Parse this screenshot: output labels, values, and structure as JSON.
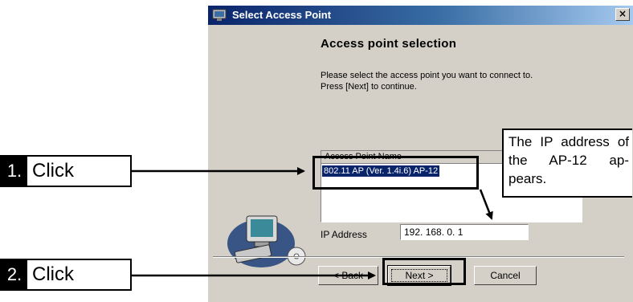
{
  "window": {
    "title": "Select Access Point",
    "close_glyph": "×"
  },
  "page": {
    "heading": "Access point selection",
    "instructions": [
      "Please select the access point you want to connect to.",
      "Press [Next] to continue."
    ]
  },
  "access_point_list": {
    "column_header": "Access Point Name",
    "items": [
      "802.11 AP (Ver. 1.4i.6) AP-12"
    ],
    "selected_index": 0
  },
  "ip_address": {
    "label": "IP Address",
    "value": "192. 168.   0.   1"
  },
  "buttons": {
    "back": "< Back",
    "next": "Next >",
    "cancel": "Cancel"
  },
  "annotations": {
    "step1": {
      "number": "1.",
      "text": "Click"
    },
    "step2": {
      "number": "2.",
      "text": "Click"
    },
    "callout": "The IP address of the AP-12 ap-pears."
  },
  "colors": {
    "title_bar": "#0a246a",
    "dialog_face": "#d4d0c8",
    "selection": "#0a246a"
  },
  "icons": [
    "title-app-icon",
    "close-icon",
    "computer-cd-icon"
  ]
}
